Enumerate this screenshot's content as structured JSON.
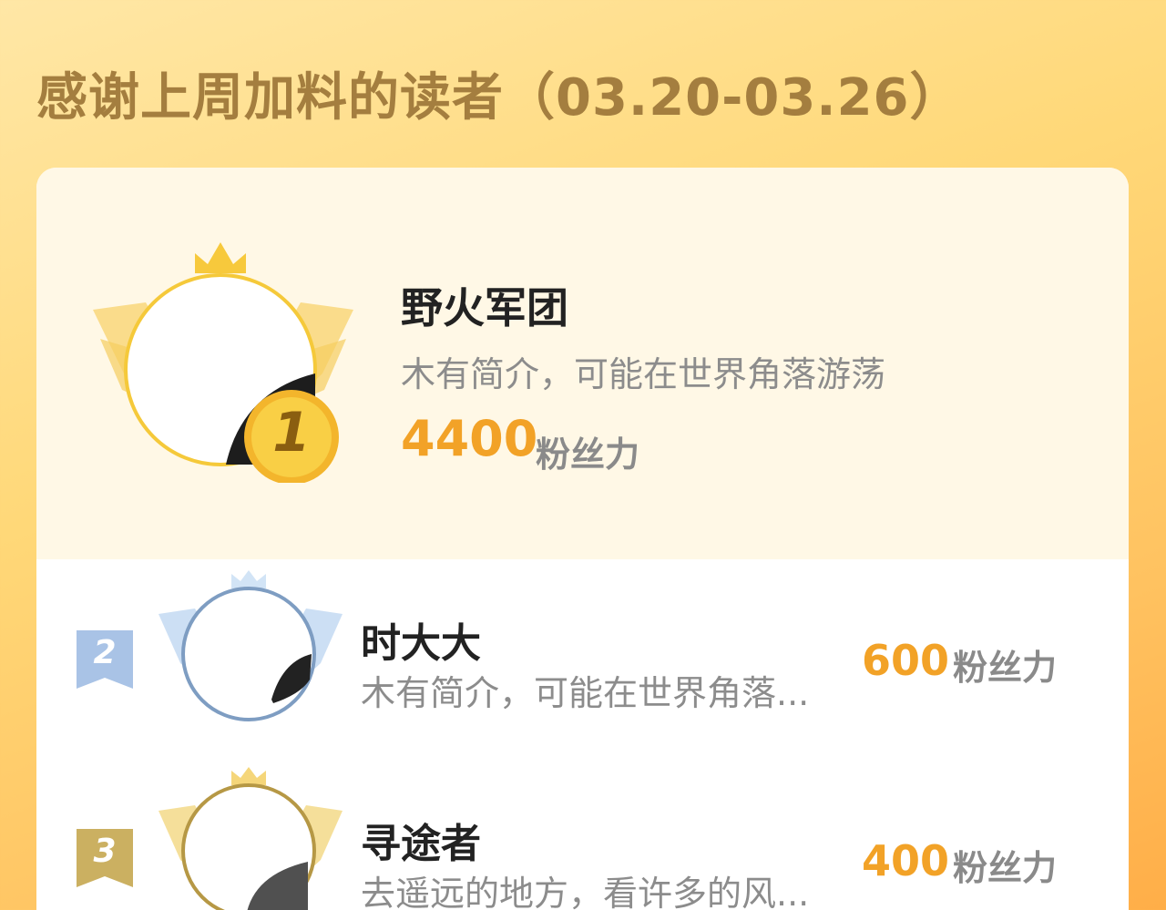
{
  "header": {
    "title": "感谢上周加料的读者（03.20-03.26）"
  },
  "leaderboard": {
    "first": {
      "rank": "1",
      "name": "野火军团",
      "description": "木有简介，可能在世界角落游荡",
      "points": "4400",
      "unit": "粉丝力"
    },
    "others": [
      {
        "rank": "2",
        "name": "时大大",
        "description": "木有简介，可能在世界角落...",
        "points": "600",
        "unit": "粉丝力"
      },
      {
        "rank": "3",
        "name": "寻途者",
        "description": "去遥远的地方，看许多的风...",
        "points": "400",
        "unit": "粉丝力"
      }
    ]
  },
  "colors": {
    "gold": "#f2a227",
    "rank1_frame": "#f5c93a",
    "rank2_frame": "#7e9dc2",
    "rank3_frame": "#b69845",
    "title_color": "#a47e3f"
  },
  "icons": {
    "rank1_badge": "crown-wings-gold-icon",
    "rank2_badge": "crown-wings-silver-icon",
    "rank3_badge": "crown-wings-bronze-icon"
  }
}
